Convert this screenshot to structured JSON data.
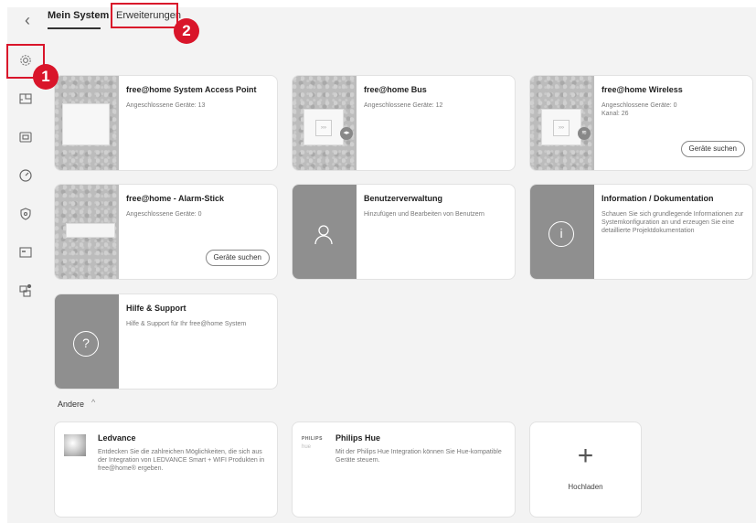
{
  "tabs": {
    "active": "Mein System",
    "ext": "Erweiterungen"
  },
  "badges": {
    "one": "1",
    "two": "2"
  },
  "cards": {
    "access_point": {
      "title": "free@home System Access Point",
      "sub": "Angeschlossene Geräte: 13"
    },
    "bus": {
      "title": "free@home Bus",
      "sub": "Angeschlossene Geräte: 12"
    },
    "wireless": {
      "title": "free@home Wireless",
      "sub1": "Angeschlossene Geräte: 0",
      "sub2": "Kanal: 26",
      "button": "Geräte suchen"
    },
    "alarm": {
      "title": "free@home - Alarm-Stick",
      "sub": "Angeschlossene Geräte: 0",
      "button": "Geräte suchen"
    },
    "users": {
      "title": "Benutzerverwaltung",
      "sub": "Hinzufügen und Bearbeiten von Benutzern"
    },
    "info": {
      "title": "Information / Dokumentation",
      "sub": "Schauen Sie sich grundlegende Informationen zur Systemkonfiguration an und erzeugen Sie eine detaillierte Projektdokumentation"
    },
    "help": {
      "title": "Hilfe & Support",
      "sub": "Hilfe & Support für Ihr free@home System"
    }
  },
  "andere": {
    "label": "Andere",
    "chevron": "^"
  },
  "integrations": {
    "ledvance": {
      "title": "Ledvance",
      "sub": "Entdecken Sie die zahlreichen Möglichkeiten, die sich aus der Integration von LEDVANCE Smart + WIFI Produkten in free@home® ergeben."
    },
    "philips": {
      "logo": "PHILIPS",
      "logo2": "hue",
      "title": "Philips Hue",
      "sub": "Mit der Philips Hue Integration können Sie Hue-kompatible Geräte steuern."
    },
    "upload": {
      "plus": "+",
      "label": "Hochladen"
    }
  },
  "icons": [
    "back-chevron-icon",
    "gear-icon",
    "floorplan-icon",
    "device-icon",
    "gauge-icon",
    "alarm-icon",
    "display-icon",
    "user-devices-icon",
    "person-icon",
    "info-icon",
    "question-icon"
  ]
}
